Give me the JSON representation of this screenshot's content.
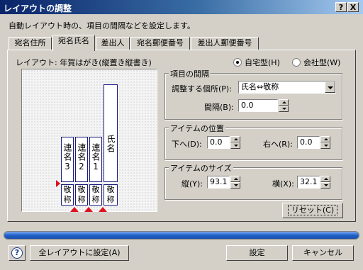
{
  "window": {
    "title": "レイアウトの調整",
    "help_btn": "?",
    "close_btn": "X"
  },
  "description": "自動レイアウト時の、項目の間隔などを設定します。",
  "tabs": [
    {
      "label": "宛名住所",
      "active": false
    },
    {
      "label": "宛名氏名",
      "active": true
    },
    {
      "label": "差出人",
      "active": false
    },
    {
      "label": "宛名郵便番号",
      "active": false
    },
    {
      "label": "差出人郵便番号",
      "active": false
    }
  ],
  "layout_label": "レイアウト: 年賀はがき(縦置き縦書き)",
  "radios": [
    {
      "label": "自宅型(H)",
      "selected": true
    },
    {
      "label": "会社型(W)",
      "selected": false
    }
  ],
  "preview": {
    "name_vertical": "氏名",
    "ren": [
      "連名3",
      "連名2",
      "連名1"
    ],
    "honorific": [
      "敬称",
      "敬称",
      "敬称",
      "敬称"
    ]
  },
  "spacing_group": {
    "title": "項目の間隔",
    "target_label": "調整する個所(P):",
    "target_value": "氏名⇔敬称",
    "interval_label": "間隔(B):",
    "interval_value": "0.0"
  },
  "position_group": {
    "title": "アイテムの位置",
    "down_label": "下へ(D):",
    "down_value": "0.0",
    "right_label": "右へ(R):",
    "right_value": "0.0"
  },
  "size_group": {
    "title": "アイテムのサイズ",
    "height_label": "縦(Y):",
    "height_value": "93.1",
    "width_label": "横(X):",
    "width_value": "32.1"
  },
  "reset_label": "リセット(C)",
  "progress": {
    "fraction": 1.0,
    "color": "#2060c8"
  },
  "footer": {
    "help_icon": "question-icon",
    "apply_all_label": "全レイアウトに設定(A)",
    "ok_label": "設定",
    "cancel_label": "キャンセル"
  },
  "colors": {
    "title_start": "#0a246a",
    "title_end": "#a6caf0",
    "marker": "#e0101f",
    "preview_border": "#1a1a80"
  }
}
